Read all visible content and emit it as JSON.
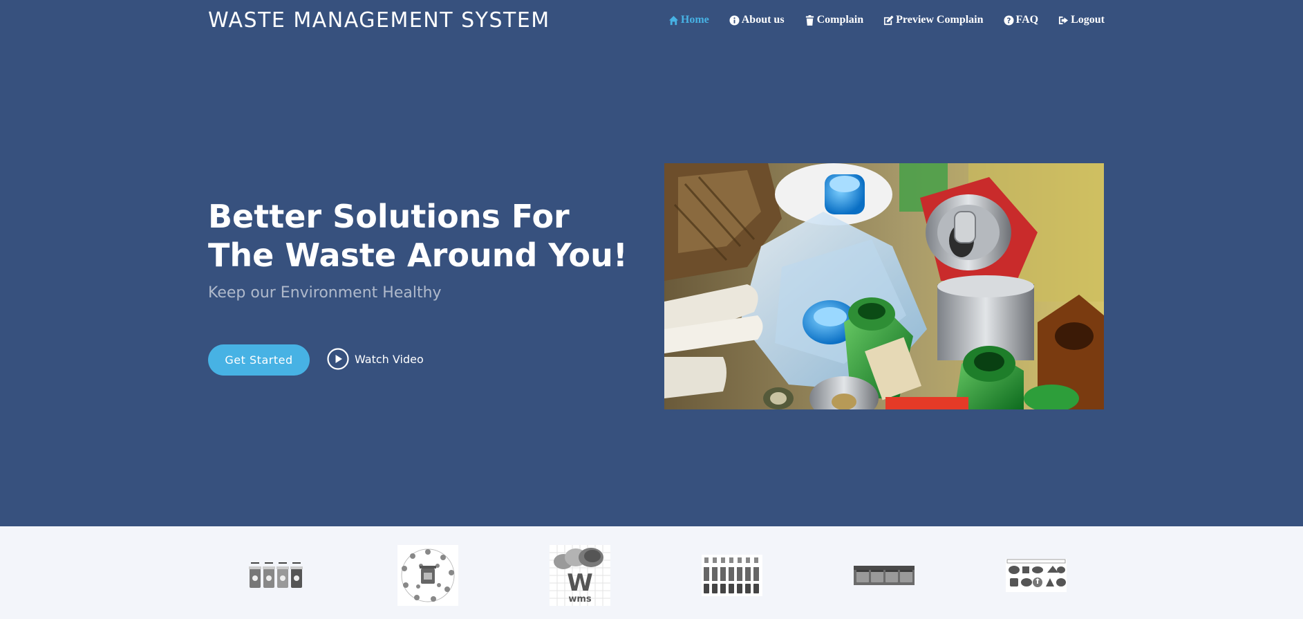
{
  "header": {
    "logo": "WASTE MANAGEMENT SYSTEM",
    "nav": [
      {
        "label": "Home",
        "icon": "home-icon",
        "active": true
      },
      {
        "label": "About us",
        "icon": "info-icon",
        "active": false
      },
      {
        "label": "Complain",
        "icon": "trash-icon",
        "active": false
      },
      {
        "label": "Preview Complain",
        "icon": "edit-icon",
        "active": false
      },
      {
        "label": "FAQ",
        "icon": "question-icon",
        "active": false
      },
      {
        "label": "Logout",
        "icon": "logout-icon",
        "active": false
      }
    ]
  },
  "hero": {
    "title": "Better Solutions For The Waste Around You!",
    "subtitle": "Keep our Environment Healthy",
    "get_started": "Get Started",
    "watch_video": "Watch Video",
    "image_subject": "recyclable waste: plastic bottles, glass bottles, cans, cardboard"
  },
  "clients": {
    "logos": [
      {
        "icon": "recycle-bins-icon"
      },
      {
        "icon": "waste-circle-icon"
      },
      {
        "icon": "wms-logo-icon",
        "text": "wms"
      },
      {
        "icon": "sorting-bins-icon"
      },
      {
        "icon": "dumpsters-icon"
      },
      {
        "icon": "waste-types-icon"
      }
    ]
  },
  "colors": {
    "background": "#37517e",
    "accent": "#47b2e4",
    "strip": "#f3f5fa"
  }
}
